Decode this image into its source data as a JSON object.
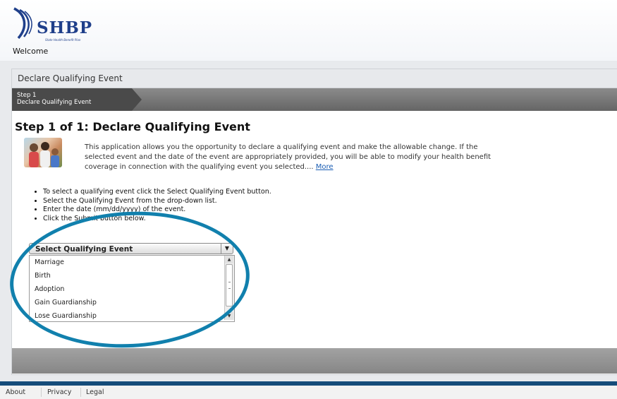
{
  "header": {
    "logo_text": "SHBP",
    "logo_subtitle": "State Health Benefit Plan",
    "welcome": "Welcome"
  },
  "panel": {
    "title": "Declare Qualifying Event",
    "step_tab": {
      "line1": "Step 1",
      "line2": "Declare Qualifying Event"
    },
    "heading": "Step 1 of 1: Declare Qualifying Event",
    "intro_text": "This application allows you the opportunity to declare a qualifying event and make the allowable change. If the selected event and the date of the event are appropriately provided, you will be able to modify your health benefit coverage in connection with the qualifying event you selected....",
    "more_link": "More",
    "instructions": [
      "To select a qualifying event click the Select Qualifying Event button.",
      "Select the Qualifying Event from the drop-down list.",
      "Enter the date (mm/dd/yyyy) of the event.",
      "Click the Submit button below."
    ],
    "dropdown": {
      "label": "Select Qualifying Event",
      "arrow": "▼",
      "options": [
        "Marriage",
        "Birth",
        "Adoption",
        "Gain Guardianship",
        "Lose Guardianship"
      ]
    }
  },
  "footer": {
    "links": [
      "About",
      "Privacy",
      "Legal"
    ]
  },
  "colors": {
    "brand": "#1f3f8a",
    "highlight_ring": "#1180ad",
    "link": "#1a5db3",
    "band": "#154c7a"
  }
}
